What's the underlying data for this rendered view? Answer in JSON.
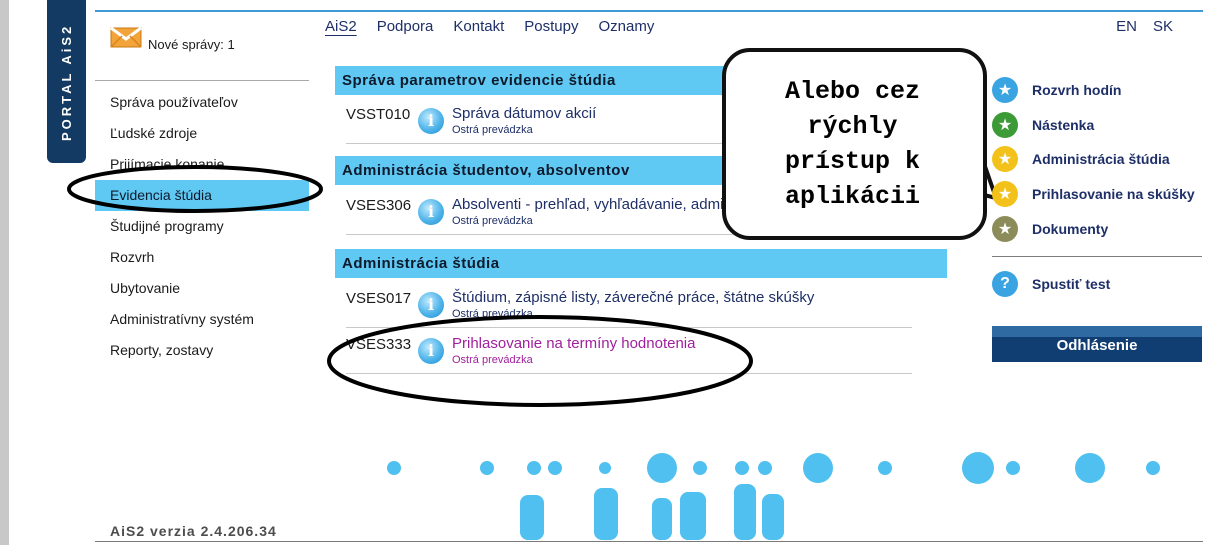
{
  "portal": {
    "vertical_label": "PORTAL AiS2"
  },
  "messages": {
    "label": "Nové správy: 1"
  },
  "left_menu": [
    {
      "label": "Správa používateľov"
    },
    {
      "label": "Ľudské zdroje"
    },
    {
      "label": "Prijímacie konanie"
    },
    {
      "label": "Evidencia štúdia",
      "active": true
    },
    {
      "label": "Študijné programy"
    },
    {
      "label": "Rozvrh"
    },
    {
      "label": "Ubytovanie"
    },
    {
      "label": "Administratívny systém"
    },
    {
      "label": "Reporty, zostavy"
    }
  ],
  "top_nav": [
    {
      "label": "AiS2",
      "active": true
    },
    {
      "label": "Podpora"
    },
    {
      "label": "Kontakt"
    },
    {
      "label": "Postupy"
    },
    {
      "label": "Oznamy"
    }
  ],
  "languages": [
    "EN",
    "SK"
  ],
  "sections": [
    {
      "title": "Správa parametrov evidencie štúdia",
      "apps": [
        {
          "code": "VSST010",
          "name": "Správa dátumov akcií",
          "status": "Ostrá prevádzka"
        }
      ]
    },
    {
      "title": "Administrácia študentov, absolventov",
      "apps": [
        {
          "code": "VSES306",
          "name": "Absolventi - prehľad, vyhľadávanie, admi",
          "status": "Ostrá prevádzka"
        }
      ]
    },
    {
      "title": "Administrácia štúdia",
      "apps": [
        {
          "code": "VSES017",
          "name": "Štúdium, zápisné listy, záverečné práce, štátne skúšky",
          "status": "Ostrá prevádzka"
        },
        {
          "code": "VSES333",
          "name": "Prihlasovanie na termíny hodnotenia",
          "status": "Ostrá prevádzka",
          "visited": true
        }
      ]
    }
  ],
  "callout": {
    "lines": [
      "Alebo cez",
      "rýchly",
      "prístup k",
      "aplikácii"
    ]
  },
  "quick_access": [
    {
      "label": "Rozvrh hodín",
      "icon": "star-blue-icon",
      "color": "#3aa4e2"
    },
    {
      "label": "Nástenka",
      "icon": "star-green-icon",
      "color": "#3c9b36"
    },
    {
      "label": "Administrácia štúdia",
      "icon": "star-yellow-icon",
      "color": "#f2c21b"
    },
    {
      "label": "Prihlasovanie na skúšky",
      "icon": "star-yellow-icon",
      "color": "#f2c21b"
    },
    {
      "label": "Dokumenty",
      "icon": "star-olive-icon",
      "color": "#8c8c5a"
    }
  ],
  "test": {
    "label": "Spustiť test",
    "icon": "help-icon",
    "color": "#3aa4e2"
  },
  "logout": {
    "label": "Odhlásenie"
  },
  "footer": {
    "version": "AiS2 verzia 2.4.206.34"
  },
  "colors": {
    "accent": "#5fc8f3",
    "navy": "#123a63",
    "link": "#1e2f68",
    "visited": "#a01f9c"
  }
}
